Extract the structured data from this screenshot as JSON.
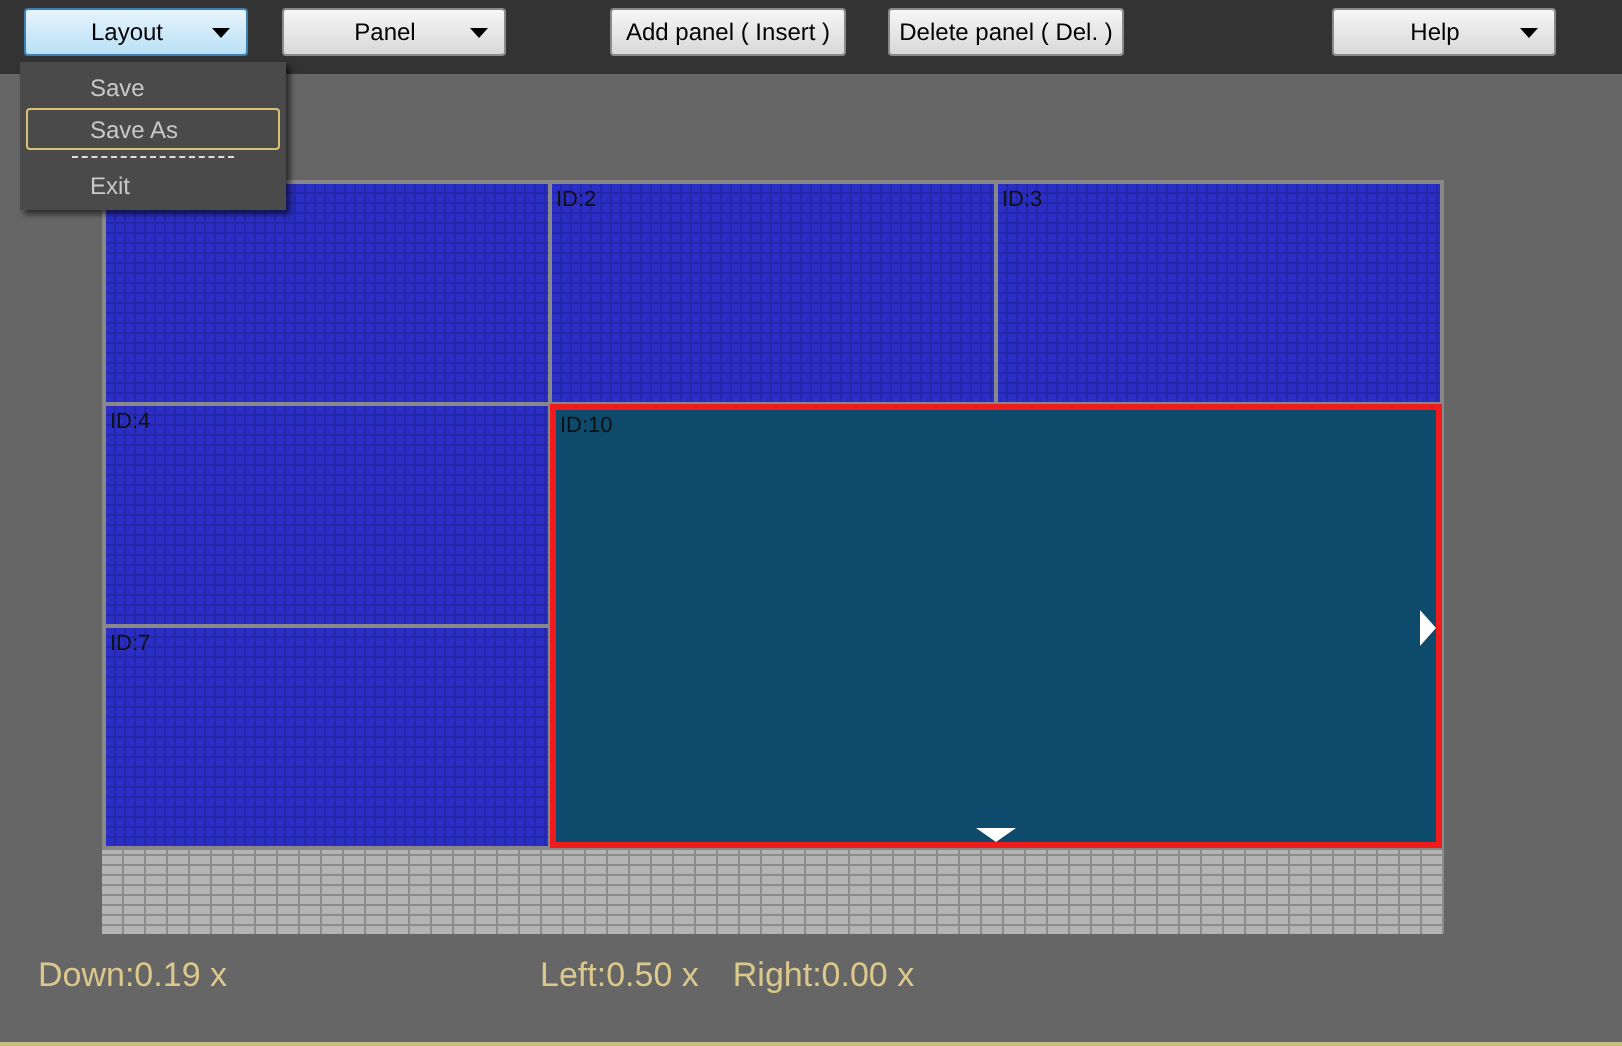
{
  "toolbar": [
    {
      "label": "Layout",
      "dropdown": true,
      "selected": true
    },
    {
      "label": "Panel",
      "dropdown": true,
      "selected": false
    },
    {
      "label": "Add panel ( Insert )",
      "dropdown": false,
      "selected": false
    },
    {
      "label": "Delete panel ( Del. )",
      "dropdown": false,
      "selected": false
    },
    {
      "label": "Help",
      "dropdown": true,
      "selected": false
    }
  ],
  "menu": {
    "items": [
      {
        "label": "Save",
        "selected": false
      },
      {
        "label": "Save As",
        "selected": true
      },
      {
        "kind": "separator"
      },
      {
        "label": "Exit",
        "selected": false
      }
    ]
  },
  "panels": [
    {
      "kind": "cell",
      "selected": false
    },
    {
      "kind": "cell",
      "label": "ID:2",
      "selected": false
    },
    {
      "kind": "cell",
      "label": "ID:3",
      "selected": false
    },
    {
      "kind": "cell",
      "label": "ID:4",
      "selected": false
    },
    {
      "kind": "large",
      "label": "ID:10",
      "selected": true
    },
    {
      "kind": "cell",
      "label": "ID:7",
      "selected": false
    }
  ],
  "status": {
    "down": "Down:0.19 x",
    "left": "Left:0.50 x",
    "right": "Right:0.00 x"
  }
}
